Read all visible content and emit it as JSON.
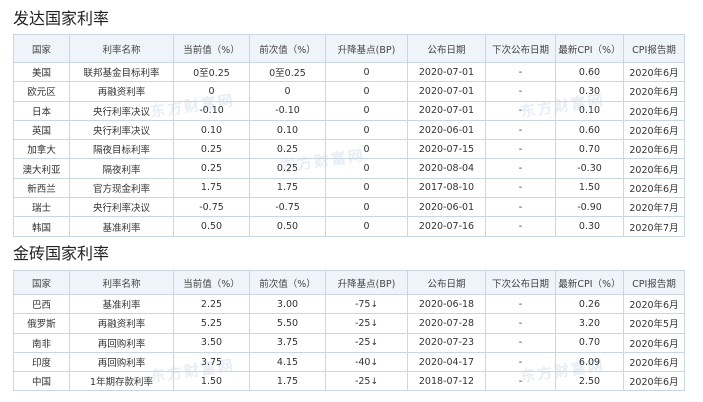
{
  "developed": {
    "title": "发达国家利率",
    "headers": [
      "国家",
      "利率名称",
      "当前值（%）",
      "前次值（%）",
      "升降基点(BP)",
      "公布日期",
      "下次公布日期",
      "最新CPI（%）",
      "CPI报告期"
    ],
    "rows": [
      [
        "美国",
        "联邦基金目标利率",
        "0至0.25",
        "0至0.25",
        "0",
        "2020-07-01",
        "-",
        "0.60",
        "2020年6月"
      ],
      [
        "欧元区",
        "再融资利率",
        "0",
        "0",
        "0",
        "2020-07-01",
        "-",
        "0.30",
        "2020年6月"
      ],
      [
        "日本",
        "央行利率决议",
        "-0.10",
        "-0.10",
        "0",
        "2020-07-01",
        "-",
        "0.10",
        "2020年6月"
      ],
      [
        "英国",
        "央行利率决议",
        "0.10",
        "0.10",
        "0",
        "2020-06-01",
        "-",
        "0.60",
        "2020年6月"
      ],
      [
        "加拿大",
        "隔夜目标利率",
        "0.25",
        "0.25",
        "0",
        "2020-07-15",
        "-",
        "0.70",
        "2020年6月"
      ],
      [
        "澳大利亚",
        "隔夜利率",
        "0.25",
        "0.25",
        "0",
        "2020-08-04",
        "-",
        "-0.30",
        "2020年6月"
      ],
      [
        "新西兰",
        "官方现金利率",
        "1.75",
        "1.75",
        "0",
        "2017-08-10",
        "-",
        "1.50",
        "2020年6月"
      ],
      [
        "瑞士",
        "央行利率决议",
        "-0.75",
        "-0.75",
        "0",
        "2020-06-01",
        "-",
        "-0.90",
        "2020年7月"
      ],
      [
        "韩国",
        "基准利率",
        "0.50",
        "0.50",
        "0",
        "2020-07-16",
        "-",
        "0.30",
        "2020年7月"
      ]
    ]
  },
  "brics": {
    "title": "金砖国家利率",
    "headers": [
      "国家",
      "利率名称",
      "当前值（%）",
      "前次值（%）",
      "升降基点(BP)",
      "公布日期",
      "下次公布日期",
      "最新CPI（%）",
      "CPI报告期"
    ],
    "rows": [
      [
        "巴西",
        "基准利率",
        "2.25",
        "3.00",
        "-75",
        "2020-06-18",
        "-",
        "0.26",
        "2020年6月"
      ],
      [
        "俄罗斯",
        "再融资利率",
        "5.25",
        "5.50",
        "-25",
        "2020-07-28",
        "-",
        "3.20",
        "2020年5月"
      ],
      [
        "南非",
        "再回购利率",
        "3.50",
        "3.75",
        "-25",
        "2020-07-23",
        "-",
        "0.70",
        "2020年6月"
      ],
      [
        "印度",
        "再回购利率",
        "3.75",
        "4.15",
        "-40",
        "2020-04-17",
        "-",
        "6.09",
        "2020年6月"
      ],
      [
        "中国",
        "1年期存款利率",
        "1.50",
        "1.75",
        "-25",
        "2018-07-12",
        "-",
        "2.50",
        "2020年6月"
      ]
    ],
    "down_arrow": "↓"
  },
  "colors": {
    "header_bg": "#eef4f9",
    "border": "#c9d7e3",
    "link": "#2a5a9c",
    "decrease": "#2aa53a"
  }
}
